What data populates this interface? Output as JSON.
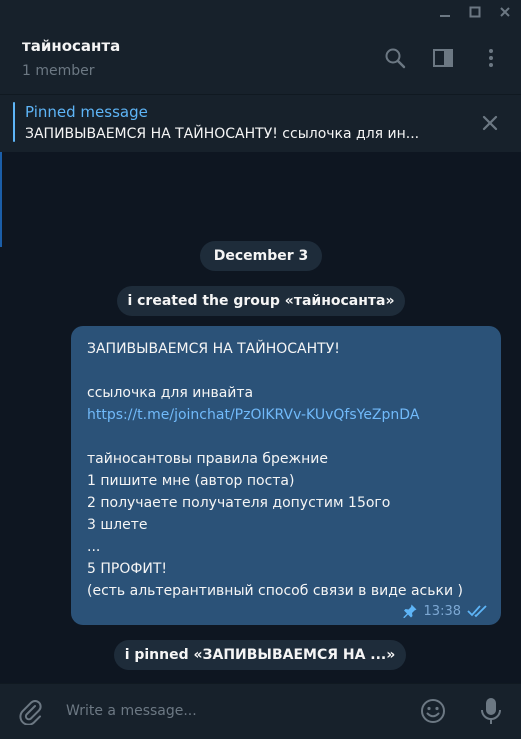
{
  "window": {
    "minimize_icon": "minimize-icon",
    "maximize_icon": "maximize-icon",
    "close_icon": "close-icon"
  },
  "header": {
    "title": "тайносанта",
    "subtitle": "1 member"
  },
  "pinned": {
    "title": "Pinned message",
    "text": "ЗАПИВЫВАЕМСЯ НА ТАЙНОСАНТУ!  ссылочка для ин..."
  },
  "chat": {
    "date": "December 3",
    "service_created": "i created the group «тайносанта»",
    "message": {
      "line1": "ЗАПИВЫВАЕМСЯ НА ТАЙНОСАНТУ!",
      "line2": "",
      "line3": "ссылочка для инвайта",
      "link": "https://t.me/joinchat/PzOlKRVv-KUvQfsYeZpnDA",
      "line5": "",
      "line6": "тайносантовы правила брежние",
      "line7": "1 пишите мне (автор поста)",
      "line8": "2 получаете получателя допустим 15ого",
      "line9": "3 шлете",
      "line10": "...",
      "line11": "5 ПРОФИТ!",
      "line12": "(есть альтерантивный способ связи в виде аськи )",
      "time": "13:38"
    },
    "service_pinned": "i pinned «ЗАПИВЫВАЕМСЯ НА ...»"
  },
  "composer": {
    "placeholder": "Write a message..."
  },
  "colors": {
    "background": "#0e1621",
    "panel": "#17212b",
    "bubble_out": "#2b5278",
    "accent": "#5eb5f7",
    "link": "#71bafa"
  }
}
